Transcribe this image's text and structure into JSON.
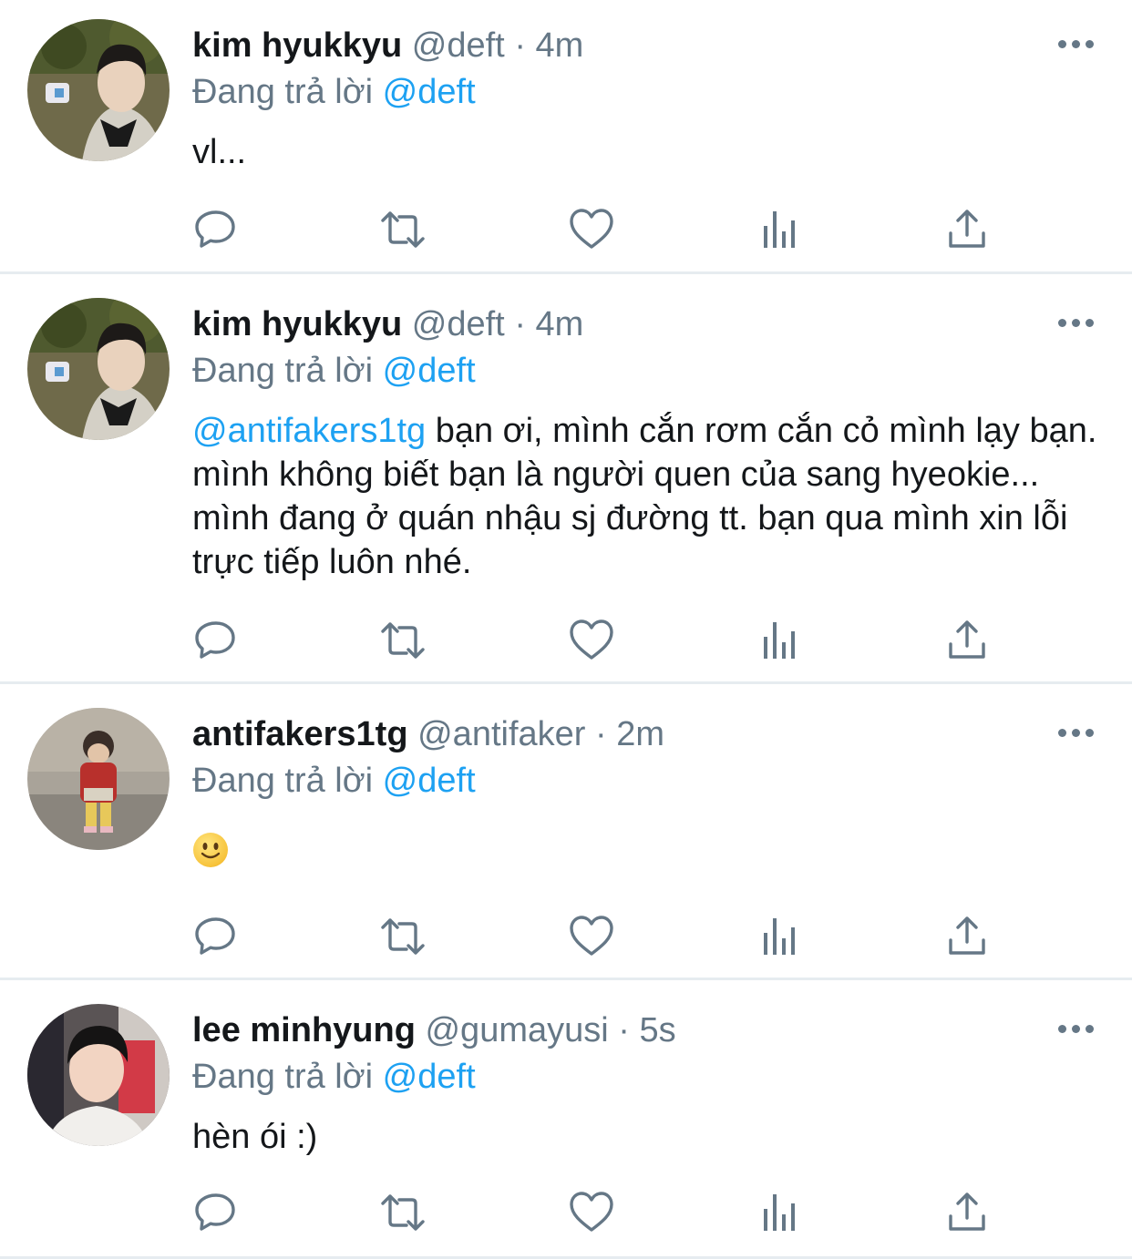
{
  "tweets": [
    {
      "display_name": "kim hyukkyu",
      "handle": "@deft",
      "separator": "·",
      "time": "4m",
      "reply_prefix": "Đang trả lời",
      "reply_to": "@deft",
      "mention": "",
      "text": "vl...",
      "avatar_icon": "avatar-photo"
    },
    {
      "display_name": "kim hyukkyu",
      "handle": "@deft",
      "separator": "·",
      "time": "4m",
      "reply_prefix": "Đang trả lời",
      "reply_to": "@deft",
      "mention": "@antifakers1tg",
      "text": " bạn ơi, mình cắn rơm cắn cỏ mình lạy bạn. mình không biết bạn là người quen của sang hyeokie... mình đang ở quán nhậu sj đường tt. bạn qua mình xin lỗi trực tiếp luôn nhé.",
      "avatar_icon": "avatar-photo"
    },
    {
      "display_name": "antifakers1tg",
      "handle": "@antifaker",
      "separator": "·",
      "time": "2m",
      "reply_prefix": "Đang trả lời",
      "reply_to": "@deft",
      "mention": "",
      "text": "",
      "emoji": "slightly-smiling-face",
      "avatar_icon": "avatar-photo"
    },
    {
      "display_name": "lee minhyung",
      "handle": "@gumayusi",
      "separator": "·",
      "time": "5s",
      "reply_prefix": "Đang trả lời",
      "reply_to": "@deft",
      "mention": "",
      "text": "hèn ói :)",
      "avatar_icon": "avatar-photo"
    }
  ],
  "actions": [
    "reply-icon",
    "retweet-icon",
    "like-icon",
    "analytics-icon",
    "share-icon"
  ],
  "colors": {
    "accent": "#1da1f2",
    "secondary_text": "#657786",
    "primary_text": "#14171a",
    "divider": "#e6ecf0",
    "icon": "#657786"
  }
}
